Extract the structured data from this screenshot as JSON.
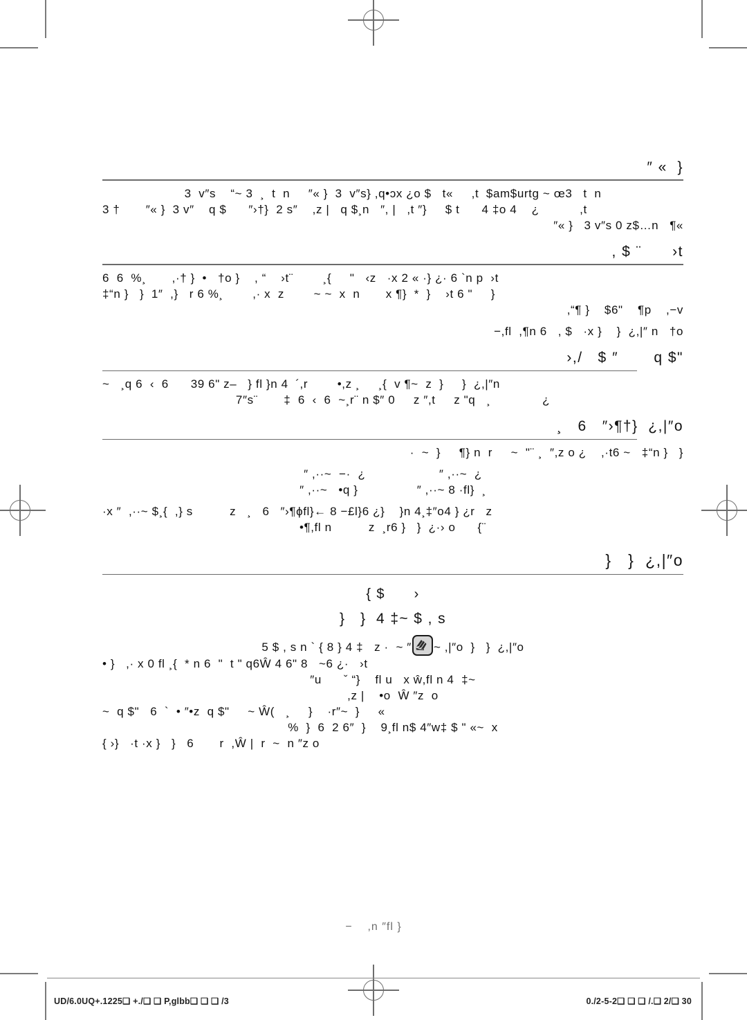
{
  "page": {
    "background_color": "#ffffff",
    "text_color": "#111111",
    "rule_color": "#6b6b6b",
    "mark_color": "#6d6d6d"
  },
  "sections": [
    {
      "id": "section-1",
      "heading": "″ «  }",
      "lines": [
        "3  v″s    “~ 3  ¸  t  n     ″« }  3  v″s} ,q•ɔx ¿o $   t«     ,t  $am$urtg ~ œ3   t  n",
        "3 †       ″« }  3 v″    q $      ″›†}  2 s″    ,z |   q $¸n   ″, |   ,t ″}     $ t      4 ‡o 4    ¿           ,t",
        "″« }   3 v″s 0 z$…n   ¶«"
      ]
    },
    {
      "id": "section-2",
      "heading": ", $ ¨      ›t",
      "lines": [
        "6  6  %¸       ,·† }  •   †o }    , “    ›t¨        ¸{     \"   ‹z   ·x 2 « ·} ¿· 6 `n p  ›t",
        "‡“n }   }  1″  ,}   r 6 %¸        ,· x  z        ~ ~  x  n       x ¶}  *  }    ›t 6 \"     }",
        ",“¶ }    $6\"    ¶p    ,−v",
        "−,fl  ,¶n 6   , $   ·x }    }  ¿,|″ n   †o"
      ]
    },
    {
      "id": "section-3",
      "heading": "›,/   $ ″       q $\"",
      "lines": [
        "~   ¸q 6  ‹  6      39 6\" z–   } fl }n 4  ´,r        •,z ¸     ¸{  v ¶~  z  }     }  ¿,|″n",
        "7″s¨       ‡  6  ‹  6  ~¸r¨ n $″ 0     z ″,t     z \"q   ¸              ¿"
      ]
    },
    {
      "id": "section-4",
      "heading": "¸   6   ″›¶†}  ¿,|″o",
      "lines": [
        "·  ~  }     ¶} n  r     ~  \"¨ ¸  ″,z o ¿    ,·t6 ~   ‡“n }   }",
        "″ ,··~  −·  ¿                    ″ ,··~  ¿",
        "″ ,··~   •q }                ″ ,··~ 8 ·fl}  ¸",
        "·x ″  ,··~ $¸{  ,} s          z   ¸   6   ″›¶ϕfl}← 8 −£l}6 ¿}    }n 4¸‡″o4 } ¿r   z",
        "•¶,fl n          z  ¸r6 }   }  ¿·› o      {¨"
      ]
    },
    {
      "id": "section-5",
      "heading": "}   }  ¿,|″o",
      "subheads": [
        "{ $      ›",
        "}   }  4 ‡~ $ , s"
      ],
      "lines": [
        "5 $ , s n ` { 8 } 4 ‡   z ·  ~ ″",
        "~ ,|″o  }   }  ¿,|″o",
        "• }   ,· x 0 fl ¸{  * n 6  \"  t \" q6Ŵ 4 6\" 8   ~6 ¿·   ›t",
        "″u      ˇ “}    fl u   x ŵ,fl n 4  ‡~",
        ",z |    •o  Ŵ ″z  o",
        "~  q $\"   6  `  • ″•z  q $\"     ~ Ŵ(   ¸     }    ·r″~  }     «",
        "%  }  6  2 6″  }    9¸fl n$ 4″w‡ $ \" «~  x",
        "{ ›}   ·t ·x }   }   6       r  ,Ŵ |  r  ~  n ″z o"
      ],
      "icon": "glove-hand-icon"
    }
  ],
  "footnote": "−    ,n ″fl }",
  "footer": {
    "left": "UD/6.0UQ+.1225❑ +./❑ ❑ P,glbb❑ ❑ ❑ /3",
    "right": "0./2-5-2❑ ❑ ❑ /.❑ 2/❑ 30"
  }
}
